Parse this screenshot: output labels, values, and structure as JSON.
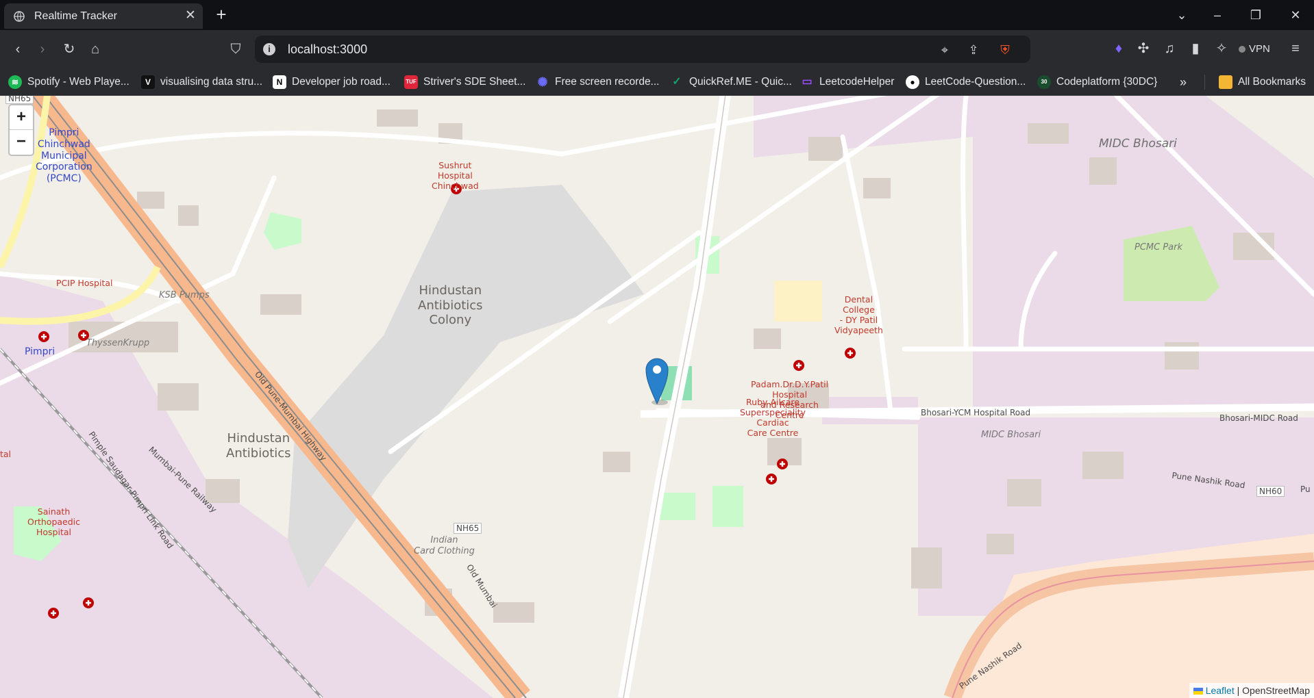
{
  "browser": {
    "tab_title": "Realtime Tracker",
    "url": "localhost:3000",
    "vpn_label": "VPN",
    "bookmarks": [
      {
        "label": "Spotify - Web Playe...",
        "icon": "spotify-icon",
        "color": "#1db954"
      },
      {
        "label": "visualising data stru...",
        "icon": "visualgo-icon",
        "color": "#111111"
      },
      {
        "label": "Developer job road...",
        "icon": "notion-icon",
        "color": "#ffffff"
      },
      {
        "label": "Striver's SDE Sheet...",
        "icon": "tuf-icon",
        "color": "#e0263b"
      },
      {
        "label": "Free screen recorde...",
        "icon": "recorder-icon",
        "color": "#5b5bf0"
      },
      {
        "label": "QuickRef.ME - Quic...",
        "icon": "quickref-icon",
        "color": "#11a36a"
      },
      {
        "label": "LeetcodeHelper",
        "icon": "leetcodehelper-icon",
        "color": "#7b2cf0"
      },
      {
        "label": "LeetCode-Question...",
        "icon": "github-icon",
        "color": "#ffffff"
      },
      {
        "label": "Codeplatform {30DC}",
        "icon": "codeplatform-icon",
        "color": "#1a4d2e"
      }
    ],
    "all_bookmarks_label": "All Bookmarks"
  },
  "map": {
    "zoom_in": "+",
    "zoom_out": "−",
    "attribution_leaflet": "Leaflet",
    "attribution_separator": " | ",
    "attribution_osm": "OpenStreetMap",
    "marker_color": "#2a81cb",
    "labels": {
      "pcmc": "Pimpri\nChinchwad\nMunicipal\nCorporation\n(PCMC)",
      "sushrut": "Sushrut\nHospital\nChinchwad",
      "midc_bhosari": "MIDC Bhosari",
      "pcmc_park": "PCMC Park",
      "pcip_hospital": "PCIP Hospital",
      "ksb_pumps": "KSB Pumps",
      "hindustan_colony": "Hindustan\nAntibiotics\nColony",
      "padam": "Padam.Dr.D.Y.Patil\nHospital\nand Research\nCentre",
      "dental": "Dental\nCollege\n- DY Patil\nVidyapeeth",
      "thyssenkrupp": "ThyssenKrupp",
      "pimpri": "Pimpri",
      "ruby": "Ruby Ailcare\nSuperspeciality\nCardiac\nCare Centre",
      "bhosari_ycm": "Bhosari-YCM Hospital Road",
      "bhosari_midc_road": "Bhosari-MIDC Road",
      "midc_bhosari_small": "MIDC Bhosari",
      "hindustan_antibiotics": "Hindustan\nAntibiotics",
      "old_pune_mumbai": "Old Pune-Mumbai Highway",
      "pimple_saudagar": "Pimple Saudagar-Pimpri Link Road",
      "mumbai_pune_railway": "Mumbai-Pune Railway",
      "pune_nashik": "Pune Nashik Road",
      "pune_nashik_2": "Pune Nashik Road",
      "nh60": "NH60",
      "nh65": "NH65",
      "nh65_top": "NH65",
      "sainath": "Sainath\nOrthopaedic\nHospital",
      "indian_card": "Indian\nCard Clothing",
      "old_mumbai": "Old Mumbai",
      "tal": "tal",
      "pu": "Pu"
    }
  }
}
